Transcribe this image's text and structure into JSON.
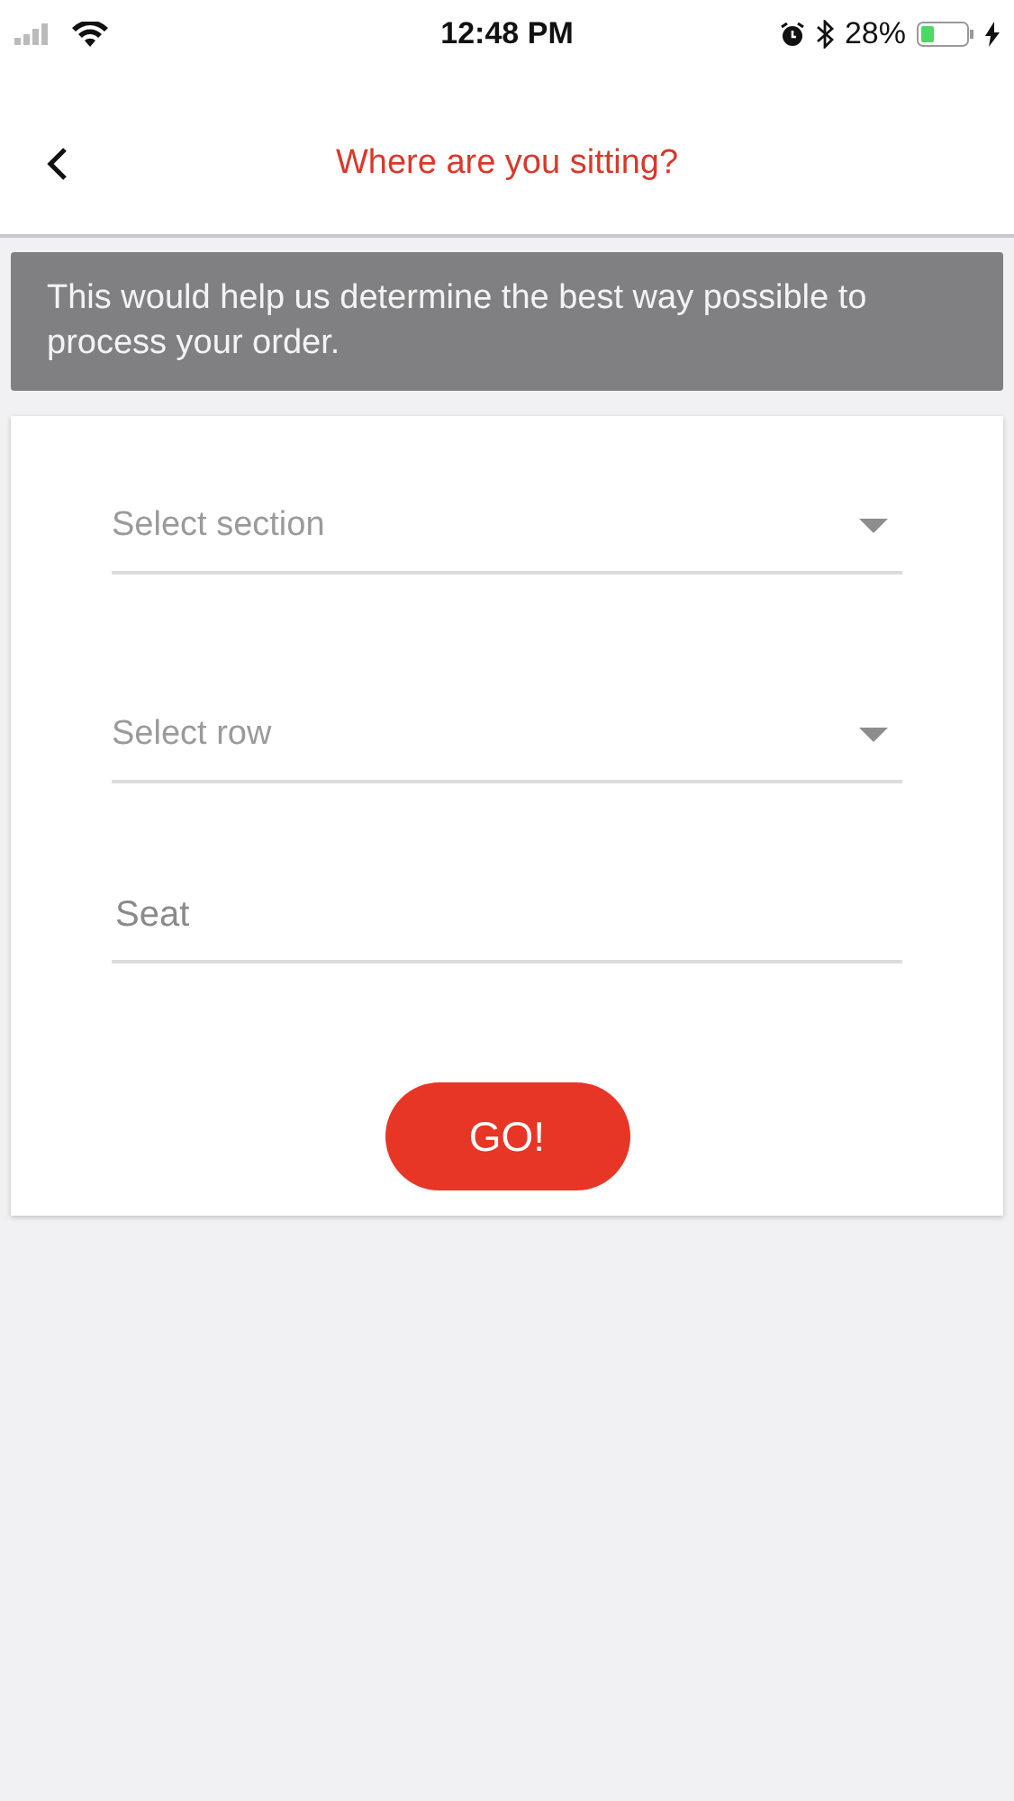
{
  "status_bar": {
    "time": "12:48 PM",
    "battery_percent": "28%"
  },
  "header": {
    "title": "Where are you sitting?"
  },
  "banner": {
    "text": "This would help us determine the best way possible to process your order."
  },
  "fields": [
    {
      "kind": "select",
      "placeholder": "Select section"
    },
    {
      "kind": "select",
      "placeholder": "Select row"
    },
    {
      "kind": "input",
      "placeholder": "Seat"
    }
  ],
  "submit_button": {
    "label": "GO!"
  }
}
